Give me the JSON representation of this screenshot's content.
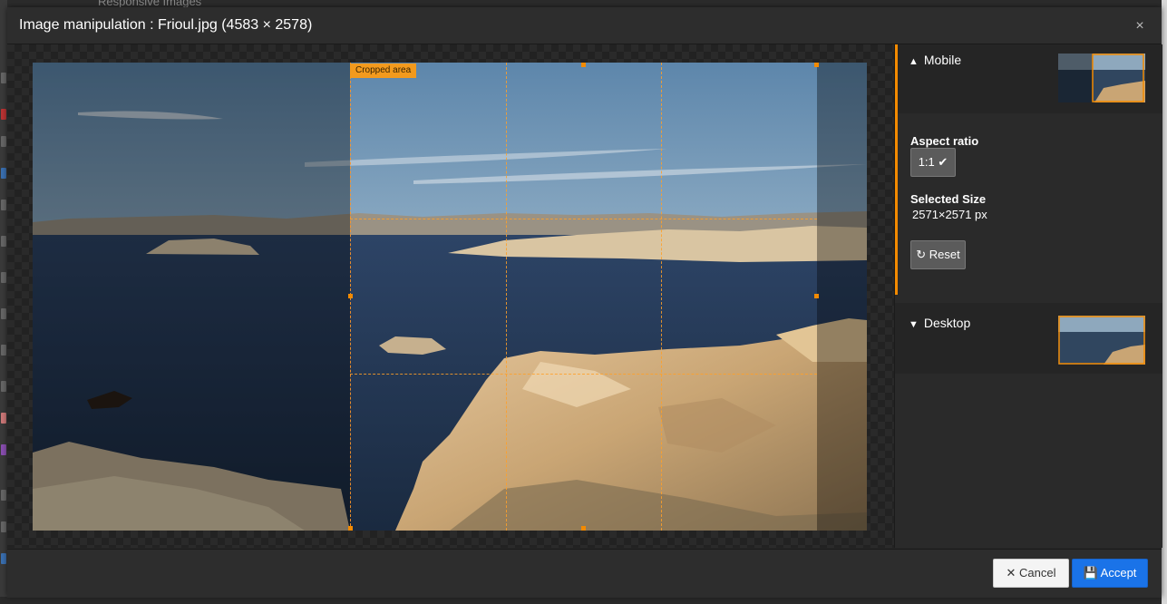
{
  "background_app": {
    "tab_title": "Responsive Images"
  },
  "modal": {
    "title": "Image manipulation : Frioul.jpg (4583 × 2578)",
    "close_icon": "×"
  },
  "stage": {
    "crop_label": "Cropped area"
  },
  "sidebar": {
    "panels": [
      {
        "label": "Mobile",
        "chevron": "up",
        "expanded": true
      },
      {
        "label": "Desktop",
        "chevron": "down",
        "expanded": false
      }
    ],
    "aspect_ratio_label": "Aspect ratio",
    "aspect_ratio_value": "1:1",
    "selected_size_label": "Selected Size",
    "selected_size_value": "2571×2571 px",
    "reset_label": "Reset"
  },
  "footer": {
    "cancel_label": "Cancel",
    "accept_label": "Accept"
  },
  "colors": {
    "accent": "#f38a00",
    "primary_button": "#1a73e8"
  }
}
